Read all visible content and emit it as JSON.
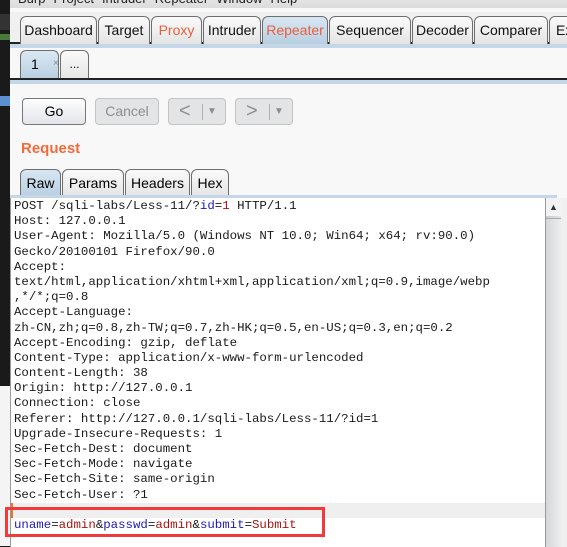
{
  "menubar": [
    "Burp",
    "Project",
    "Intruder",
    "Repeater",
    "Window",
    "Help"
  ],
  "main_tabs": [
    {
      "label": "Dashboard",
      "state": "normal"
    },
    {
      "label": "Target",
      "state": "normal"
    },
    {
      "label": "Proxy",
      "state": "highlighted"
    },
    {
      "label": "Intruder",
      "state": "normal"
    },
    {
      "label": "Repeater",
      "state": "active"
    },
    {
      "label": "Sequencer",
      "state": "normal"
    },
    {
      "label": "Decoder",
      "state": "normal"
    },
    {
      "label": "Comparer",
      "state": "normal"
    },
    {
      "label": "Ex",
      "state": "normal"
    }
  ],
  "repeater_tabs": [
    {
      "label": "1",
      "close": "×",
      "active": true
    },
    {
      "label": "...",
      "active": false
    }
  ],
  "toolbar": {
    "go_label": "Go",
    "cancel_label": "Cancel",
    "back_glyph": "<",
    "forward_glyph": ">",
    "dropdown_glyph": "▼"
  },
  "request": {
    "title": "Request",
    "tabs": [
      "Raw",
      "Params",
      "Headers",
      "Hex"
    ],
    "active_tab": "Raw",
    "request_line": {
      "method_path": "POST /sqli-labs/Less-11/?",
      "param_key": "id",
      "eq": "=",
      "param_value": "1",
      "version": " HTTP/1.1"
    },
    "headers": [
      "Host: 127.0.0.1",
      "User-Agent: Mozilla/5.0 (Windows NT 10.0; Win64; x64; rv:90.0)",
      "Gecko/20100101 Firefox/90.0",
      "Accept:",
      "text/html,application/xhtml+xml,application/xml;q=0.9,image/webp",
      ",*/*;q=0.8",
      "Accept-Language:",
      "zh-CN,zh;q=0.8,zh-TW;q=0.7,zh-HK;q=0.5,en-US;q=0.3,en;q=0.2",
      "Accept-Encoding: gzip, deflate",
      "Content-Type: application/x-www-form-urlencoded",
      "Content-Length: 38",
      "Origin: http://127.0.0.1",
      "Connection: close",
      "Referer: http://127.0.0.1/sqli-labs/Less-11/?id=1",
      "Upgrade-Insecure-Requests: 1",
      "Sec-Fetch-Dest: document",
      "Sec-Fetch-Mode: navigate",
      "Sec-Fetch-Site: same-origin",
      "Sec-Fetch-User: ?1"
    ],
    "body": {
      "params": [
        {
          "key": "uname",
          "value": "admin"
        },
        {
          "key": "passwd",
          "value": "admin"
        },
        {
          "key": "submit",
          "value": "Submit"
        }
      ],
      "eq": "=",
      "amp": "&"
    }
  },
  "scrollbar": {
    "up_glyph": "▲"
  },
  "colors": {
    "accent_orange": "#f26b3a",
    "param_key": "#1d1ab4",
    "param_value": "#a31515",
    "annotation_red": "#ef3b3b"
  }
}
